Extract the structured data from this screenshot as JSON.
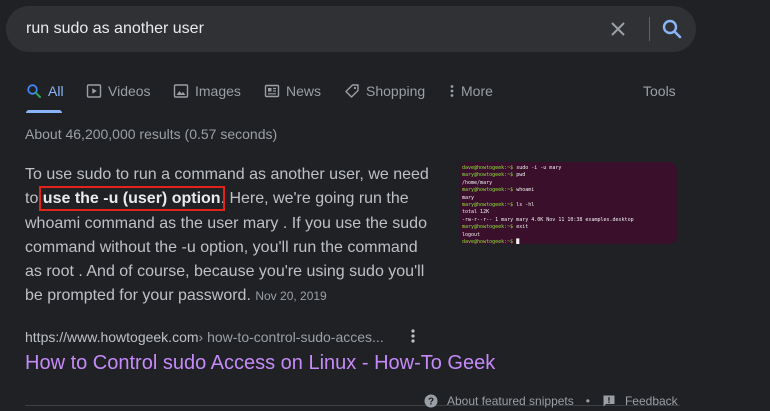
{
  "search": {
    "query": "run sudo as another user"
  },
  "tabs": [
    {
      "label": "All",
      "icon": "search-icon",
      "active": true
    },
    {
      "label": "Videos",
      "icon": "video-icon"
    },
    {
      "label": "Images",
      "icon": "image-icon"
    },
    {
      "label": "News",
      "icon": "news-icon"
    },
    {
      "label": "Shopping",
      "icon": "tag-icon"
    },
    {
      "label": "More",
      "icon": "more-vert-icon"
    }
  ],
  "tools_label": "Tools",
  "result_stats": "About 46,200,000 results (0.57 seconds)",
  "snippet": {
    "text_before": "To use sudo to run a command as another user, we need to ",
    "highlight": "use the -u (user) option",
    "text_after": ". Here, we're going run the whoami command as the user mary . If you use the sudo command without the -u option, you'll run the command as root . And of course, because you're using sudo you'll be prompted for your password. ",
    "date": "Nov 20, 2019"
  },
  "thumbnail": {
    "lines": [
      {
        "prompt": "dave@howtogeek:~$",
        "cmd": " sudo -i -u mary"
      },
      {
        "prompt": "mary@howtogeek:~$",
        "cmd": " pwd"
      },
      {
        "prompt": "",
        "cmd": "/home/mary"
      },
      {
        "prompt": "mary@howtogeek:~$",
        "cmd": " whoami"
      },
      {
        "prompt": "",
        "cmd": "mary"
      },
      {
        "prompt": "mary@howtogeek:~$",
        "cmd": " ls -hl"
      },
      {
        "prompt": "",
        "cmd": "total 12K"
      },
      {
        "prompt": "",
        "cmd": "-rw-r--r-- 1 mary mary 4.0K Nov 11 10:38 examples.desktop"
      },
      {
        "prompt": "mary@howtogeek:~$",
        "cmd": " exit"
      },
      {
        "prompt": "",
        "cmd": "logout"
      },
      {
        "prompt": "dave@howtogeek:~$",
        "cmd": " █"
      }
    ]
  },
  "result": {
    "site": "https://www.howtogeek.com",
    "path": " › how-to-control-sudo-acces...",
    "title": "How to Control sudo Access on Linux - How-To Geek"
  },
  "footer": {
    "about_label": "About featured snippets",
    "separator": "•",
    "feedback_label": "Feedback"
  },
  "colors": {
    "background": "#202124",
    "link_visited": "#c58af9",
    "accent": "#8ab4f8",
    "highlight_box": "#e2231a"
  }
}
